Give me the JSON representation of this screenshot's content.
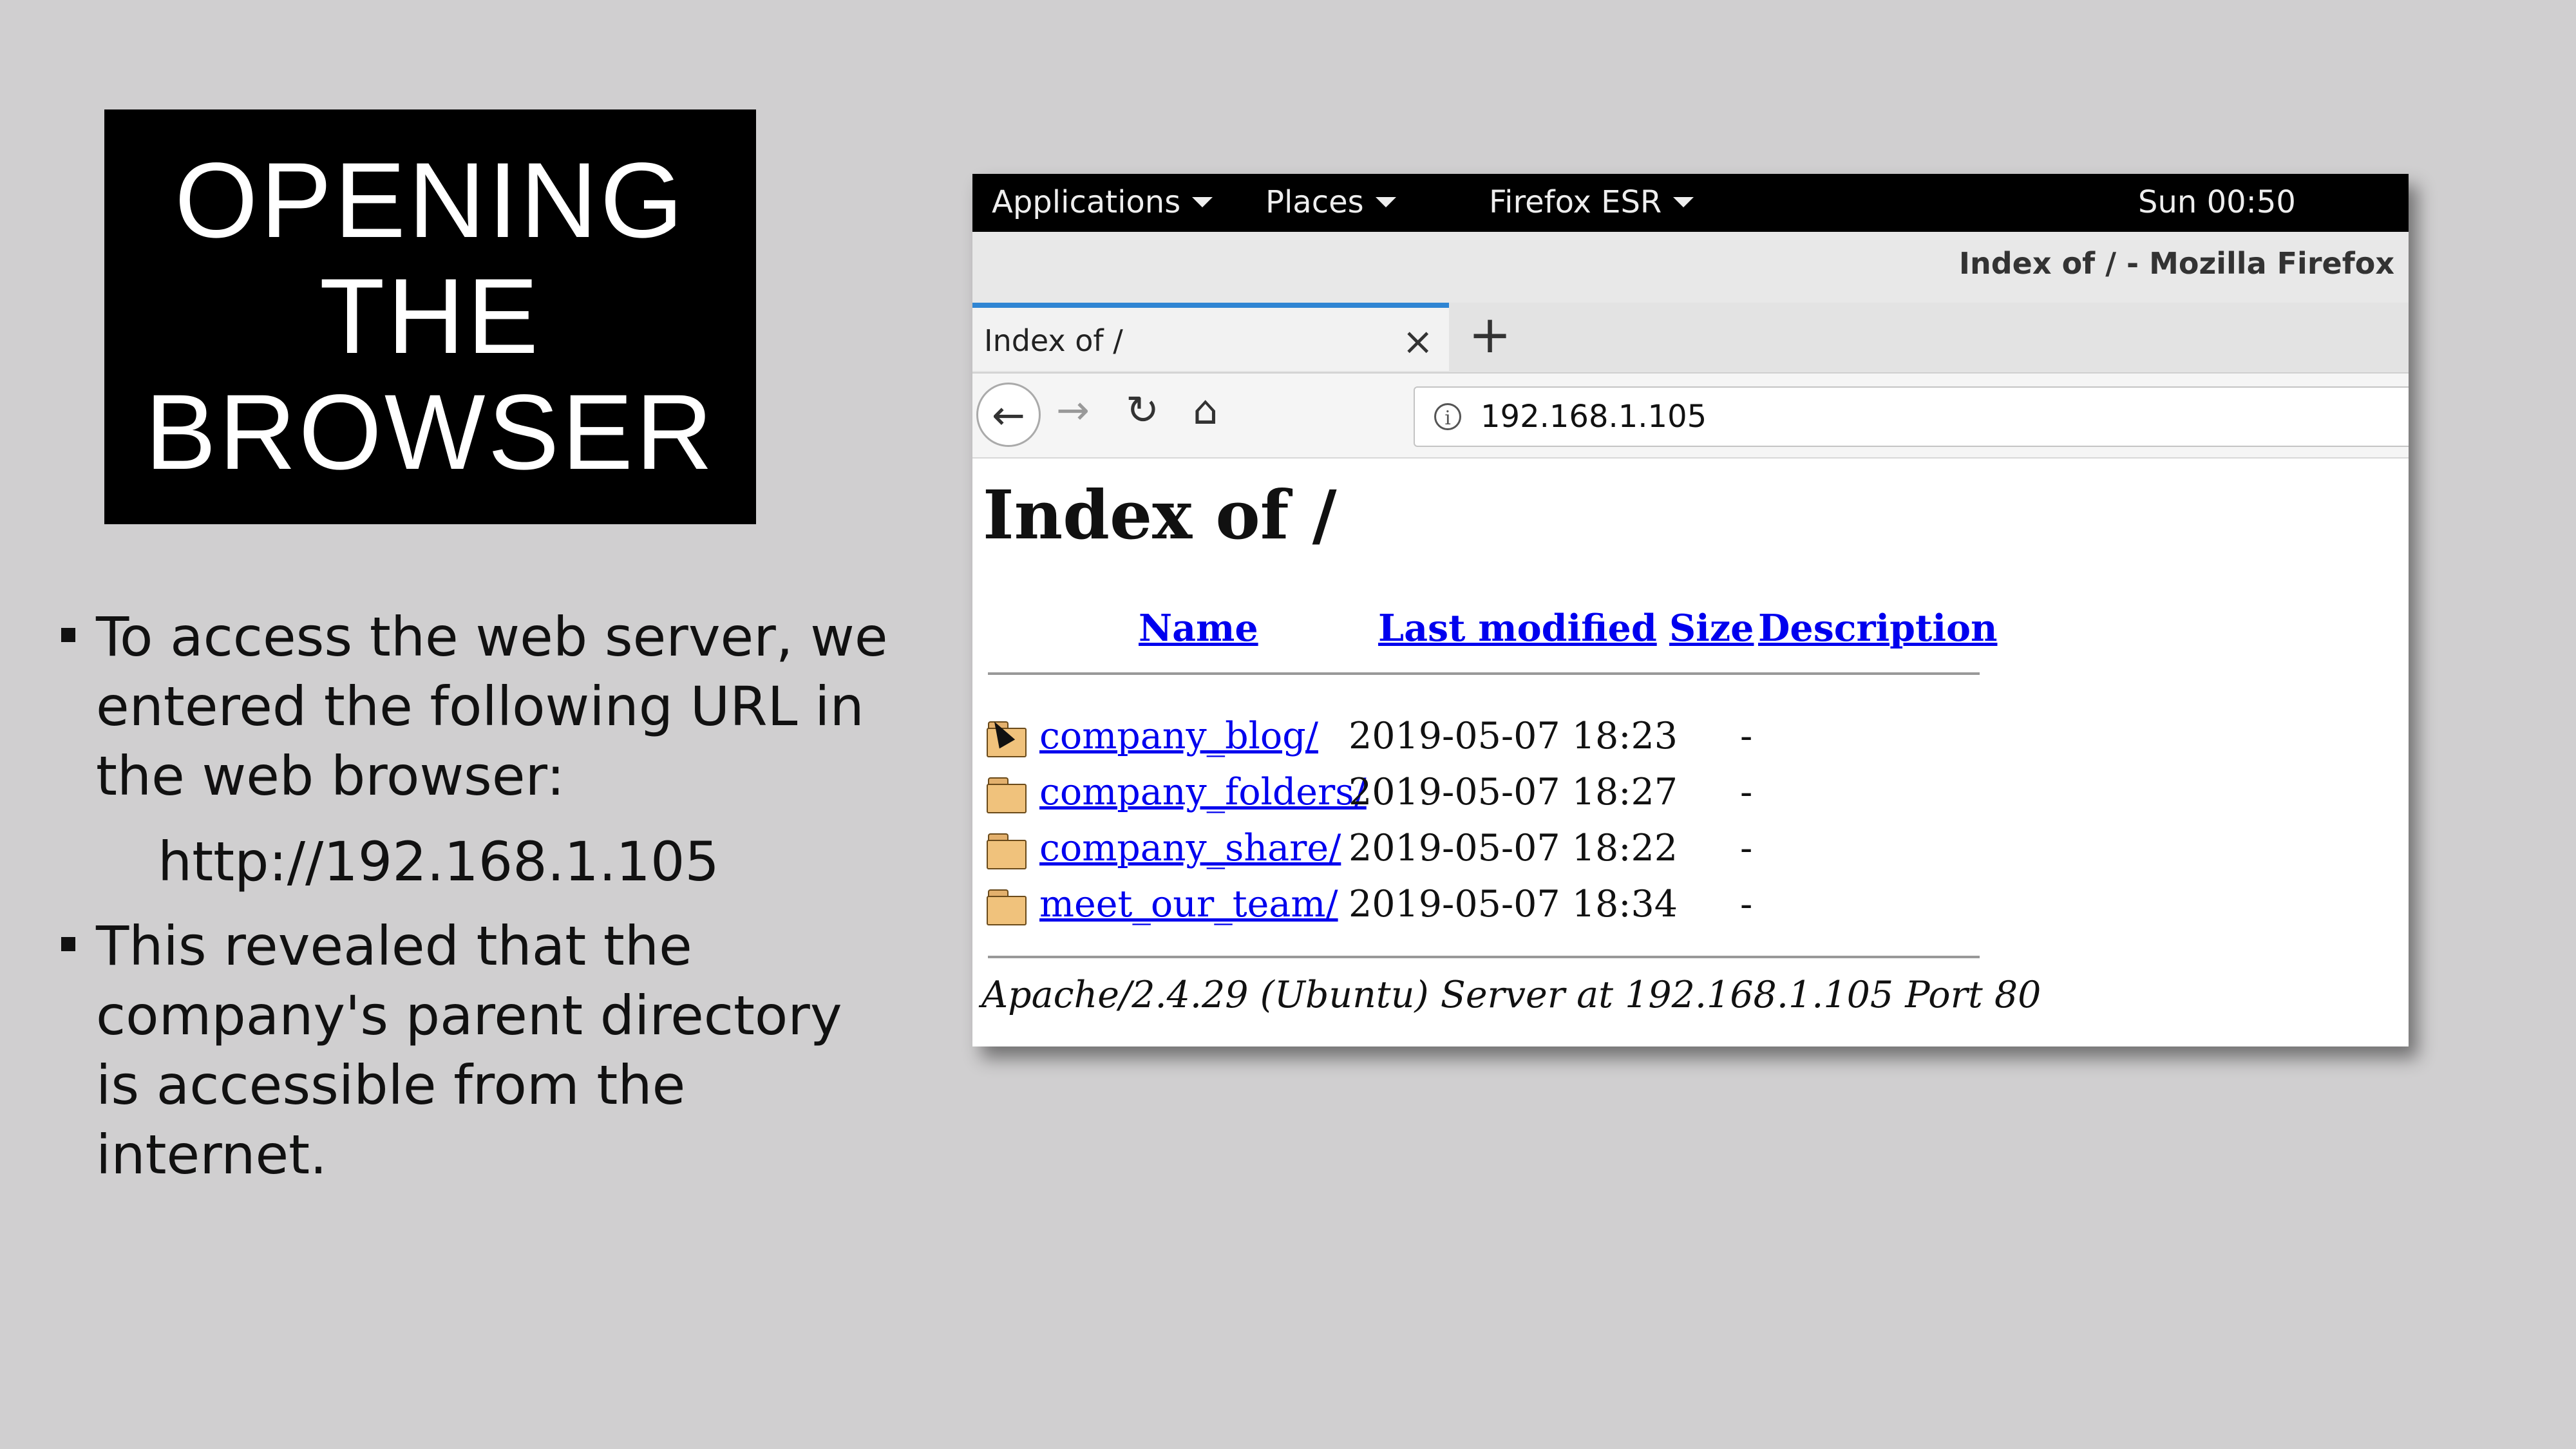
{
  "slide": {
    "title_lines": [
      "OPENING",
      "THE",
      "BROWSER"
    ],
    "bullets": [
      "To access the web server, we entered the following URL in the web browser:",
      "This revealed that the company's parent directory is accessible from the internet."
    ],
    "url_example": "http://192.168.1.105"
  },
  "browser": {
    "top_bar": {
      "applications": "Applications",
      "places": "Places",
      "firefox": "Firefox ESR",
      "clock": "Sun 00:50"
    },
    "window_title": "Index of / - Mozilla Firefox",
    "tab": {
      "label": "Index of /",
      "close": "×",
      "new_tab": "+"
    },
    "nav": {
      "back": "←",
      "forward": "→",
      "reload": "↻",
      "home": "⌂"
    },
    "address": {
      "info": "i",
      "url": "192.168.1.105"
    },
    "page": {
      "heading": "Index of /",
      "columns": {
        "name": "Name",
        "last_modified": "Last modified",
        "size": "Size",
        "description": "Description"
      },
      "entries": [
        {
          "name": "company_blog/",
          "modified": "2019-05-07 18:23",
          "size": "-"
        },
        {
          "name": "company_folders/",
          "modified": "2019-05-07 18:27",
          "size": "-"
        },
        {
          "name": "company_share/",
          "modified": "2019-05-07 18:22",
          "size": "-"
        },
        {
          "name": "meet_our_team/",
          "modified": "2019-05-07 18:34",
          "size": "-"
        }
      ],
      "server_signature": "Apache/2.4.29 (Ubuntu) Server at 192.168.1.105 Port 80"
    }
  }
}
